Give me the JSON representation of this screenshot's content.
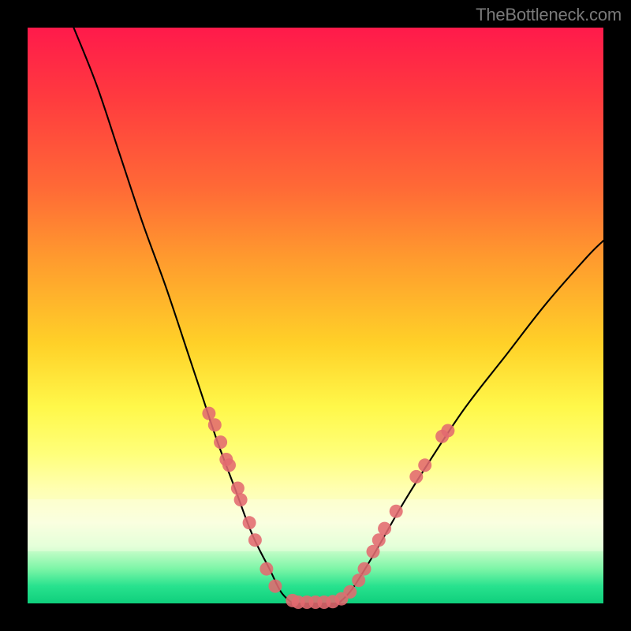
{
  "watermark": "TheBottleneck.com",
  "colors": {
    "frame": "#000000",
    "curve": "#000000",
    "marker": "#e26a6f",
    "gradient_top": "#ff1a4b",
    "gradient_bottom": "#0fcf7c"
  },
  "chart_data": {
    "type": "line",
    "title": "",
    "xlabel": "",
    "ylabel": "",
    "xlim": [
      0,
      100
    ],
    "ylim": [
      0,
      100
    ],
    "grid": false,
    "legend": false,
    "series": [
      {
        "name": "bottleneck-curve-left",
        "x": [
          8,
          12,
          16,
          20,
          24,
          28,
          30,
          33,
          36,
          39,
          42,
          44,
          46
        ],
        "y": [
          100,
          90,
          78,
          66,
          55,
          43,
          37,
          28,
          20,
          12,
          6,
          2,
          0
        ]
      },
      {
        "name": "bottleneck-curve-flat",
        "x": [
          46,
          48,
          50,
          52,
          54
        ],
        "y": [
          0,
          0,
          0,
          0,
          0
        ]
      },
      {
        "name": "bottleneck-curve-right",
        "x": [
          54,
          56,
          58,
          61,
          65,
          70,
          76,
          83,
          90,
          97,
          100
        ],
        "y": [
          0,
          2,
          5,
          10,
          17,
          25,
          34,
          43,
          52,
          60,
          63
        ]
      }
    ],
    "markers": [
      {
        "x": 31.5,
        "y": 33
      },
      {
        "x": 32.5,
        "y": 31
      },
      {
        "x": 33.5,
        "y": 28
      },
      {
        "x": 34.5,
        "y": 25
      },
      {
        "x": 35.0,
        "y": 24
      },
      {
        "x": 36.5,
        "y": 20
      },
      {
        "x": 37.0,
        "y": 18
      },
      {
        "x": 38.5,
        "y": 14
      },
      {
        "x": 39.5,
        "y": 11
      },
      {
        "x": 41.5,
        "y": 6
      },
      {
        "x": 43.0,
        "y": 3
      },
      {
        "x": 46.0,
        "y": 0.5
      },
      {
        "x": 47.0,
        "y": 0.2
      },
      {
        "x": 48.5,
        "y": 0.2
      },
      {
        "x": 50.0,
        "y": 0.2
      },
      {
        "x": 51.5,
        "y": 0.2
      },
      {
        "x": 53.0,
        "y": 0.3
      },
      {
        "x": 54.5,
        "y": 0.8
      },
      {
        "x": 56.0,
        "y": 2
      },
      {
        "x": 57.5,
        "y": 4
      },
      {
        "x": 58.5,
        "y": 6
      },
      {
        "x": 60.0,
        "y": 9
      },
      {
        "x": 61.0,
        "y": 11
      },
      {
        "x": 62.0,
        "y": 13
      },
      {
        "x": 64.0,
        "y": 16
      },
      {
        "x": 67.5,
        "y": 22
      },
      {
        "x": 69.0,
        "y": 24
      },
      {
        "x": 72.0,
        "y": 29
      },
      {
        "x": 73.0,
        "y": 30
      }
    ]
  }
}
